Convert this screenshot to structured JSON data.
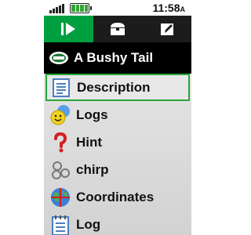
{
  "status": {
    "time": "11:58",
    "time_suffix": "A"
  },
  "tabs": [
    {
      "icon": "play-icon",
      "active": true
    },
    {
      "icon": "treasure-chest-icon",
      "active": false
    },
    {
      "icon": "map-pencil-icon",
      "active": false
    }
  ],
  "header": {
    "title": "A Bushy Tail",
    "icon": "geocache-icon"
  },
  "menu": {
    "items": [
      {
        "label": "Description",
        "icon": "document-icon",
        "selected": true
      },
      {
        "label": "Logs",
        "icon": "smiley-faces-icon",
        "selected": false
      },
      {
        "label": "Hint",
        "icon": "question-mark-icon",
        "selected": false
      },
      {
        "label": "chirp",
        "icon": "chirp-icon",
        "selected": false
      },
      {
        "label": "Coordinates",
        "icon": "globe-icon",
        "selected": false
      },
      {
        "label": "Log",
        "icon": "notepad-icon",
        "selected": false
      }
    ]
  },
  "colors": {
    "accent": "#00a040",
    "tab_bar": "#1c1c1c",
    "selection_border": "#2aa63a",
    "battery": "#34a534"
  }
}
